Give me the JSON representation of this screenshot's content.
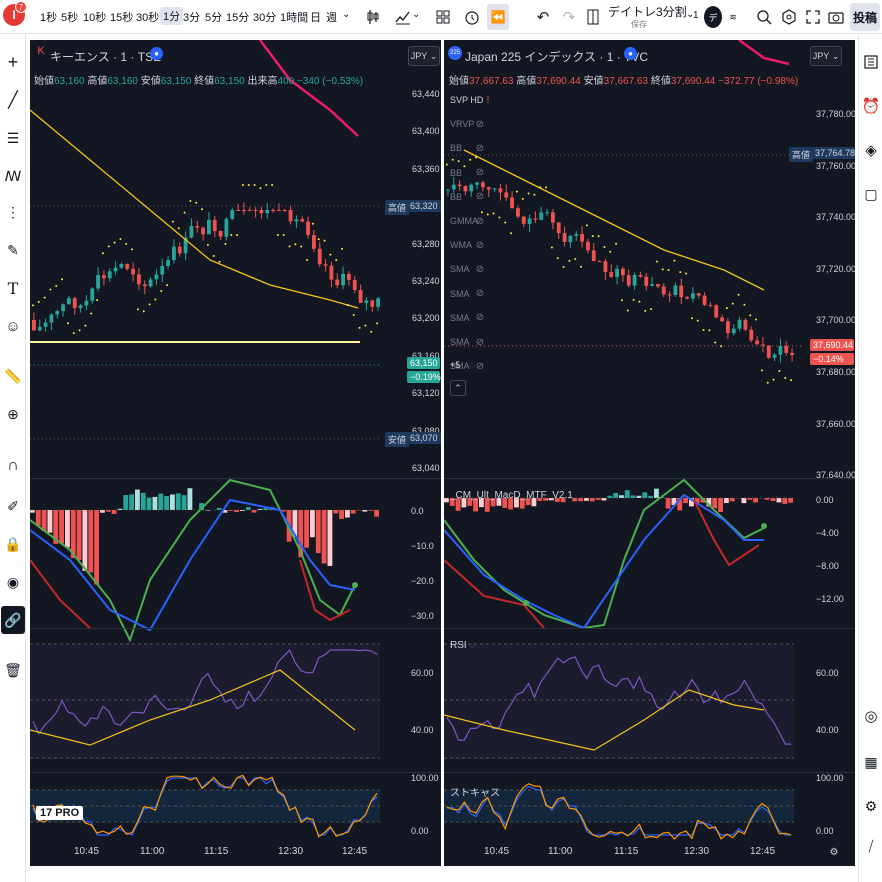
{
  "toolbar": {
    "avatar_letter": "I",
    "avatar_badge": "7",
    "intervals": [
      "1秒",
      "5秒",
      "10秒",
      "15秒",
      "30秒",
      "1分",
      "3分",
      "5分",
      "15分",
      "30分",
      "1時間",
      "日",
      "週"
    ],
    "layout_name": "デイトレ3分割",
    "layout_sub": "保存",
    "counter": "1",
    "publish": "投稿"
  },
  "left": {
    "symbol": "キーエンス · 1 · TSE",
    "currency": "JPY",
    "ohlc": {
      "o_lbl": "始値",
      "o": "63,160",
      "h_lbl": "高値",
      "h": "63,160",
      "l_lbl": "安値",
      "l": "63,150",
      "c_lbl": "終値",
      "c": "63,150",
      "vol_lbl": "出来高",
      "vol": "400",
      "chg": "−340 (−0.53%)"
    },
    "yaxis": [
      "63,440",
      "63,400",
      "63,360",
      "63,320",
      "63,280",
      "63,240",
      "63,200",
      "63,160",
      "63,120",
      "63,080",
      "63,040"
    ],
    "high_tag": "高値",
    "high_val": "63,320",
    "low_tag": "安値",
    "low_val": "63,070",
    "price_tag": "63,150",
    "price_pct": "−0.19%",
    "macd_axis": [
      "0.0",
      "−10.0",
      "−20.0",
      "−30.0"
    ],
    "rsi_axis": [
      "60.00",
      "40.00"
    ],
    "stoch_axis": [
      "100.00",
      "0.00"
    ],
    "xaxis": [
      "10:45",
      "11:00",
      "11:15",
      "12:30",
      "12:45"
    ],
    "logo": "17 PRO"
  },
  "right": {
    "symbol": "Japan 225 インデックス · 1 · TVC",
    "currency": "JPY",
    "badge": "225",
    "ohlc": {
      "o_lbl": "始値",
      "o": "37,667.63",
      "h_lbl": "高値",
      "h": "37,690.44",
      "l_lbl": "安値",
      "l": "37,667.63",
      "c_lbl": "終値",
      "c": "37,690.44",
      "chg": "−372.77 (−0.98%)"
    },
    "indicators": [
      "SVP HD",
      "VRVP",
      "BB",
      "BB",
      "BB",
      "GMMA",
      "WMA",
      "SMA",
      "SMA",
      "SMA",
      "SMA",
      "SMA"
    ],
    "more": "+5",
    "yaxis": [
      "37,780.00",
      "37,760.00",
      "37,740.00",
      "37,720.00",
      "37,700.00",
      "37,680.00",
      "37,660.00",
      "37,640.00"
    ],
    "high_tag": "高値",
    "high_val": "37,764.78",
    "price_tag": "37,690.44",
    "price_pct": "−0.14%",
    "macd_title": "_CM_Ult_MacD_MTF_V2.1",
    "macd_axis": [
      "0.00",
      "−4.00",
      "−8.00",
      "−12.00"
    ],
    "rsi_title": "RSI",
    "rsi_axis": [
      "60.00",
      "40.00"
    ],
    "stoch_title": "ストキャス",
    "stoch_axis": [
      "100.00",
      "0.00"
    ],
    "xaxis": [
      "10:45",
      "11:00",
      "11:15",
      "12:30",
      "12:45"
    ]
  },
  "colors": {
    "bg": "#131722",
    "up": "#26a69a",
    "down": "#ef5350",
    "ma": "#f5c518",
    "sma": "#e91e63",
    "rsi": "#7e57c2",
    "stoch_k": "#2962ff",
    "stoch_d": "#ff9800",
    "macd_fast": "#4caf50",
    "macd_slow": "#2962ff",
    "macd_red": "#c62828"
  }
}
